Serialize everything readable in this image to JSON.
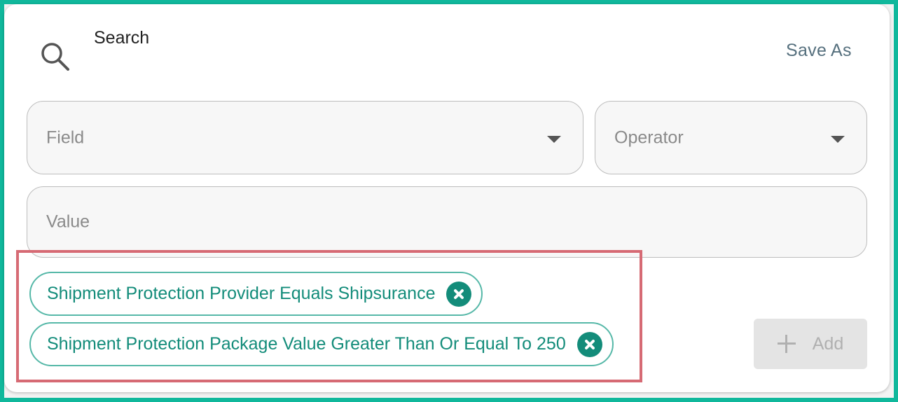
{
  "header": {
    "title": "Search",
    "save_as_label": "Save As",
    "search_icon": "search-icon"
  },
  "filter_form": {
    "field_placeholder": "Field",
    "operator_placeholder": "Operator",
    "value_placeholder": "Value",
    "add_label": "Add",
    "add_icon": "plus-icon"
  },
  "filters": [
    {
      "label": "Shipment Protection Provider Equals Shipsurance"
    },
    {
      "label": "Shipment Protection Package Value Greater Than Or Equal To 250"
    }
  ],
  "colors": {
    "frame_border": "#10b89c",
    "chip_accent": "#138c7a",
    "highlight_border": "#d66a74",
    "save_as_text": "#56707e"
  }
}
